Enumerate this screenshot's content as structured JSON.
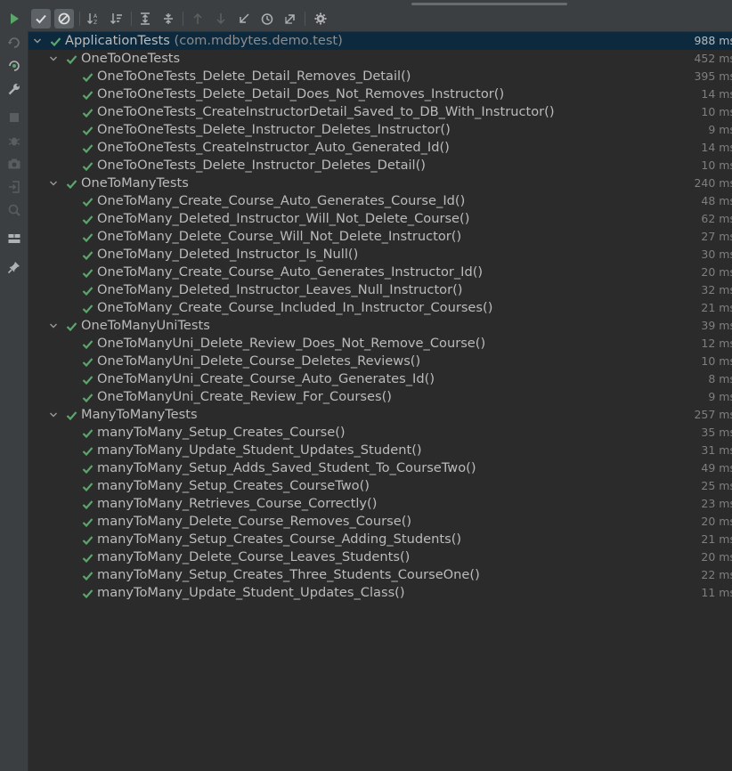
{
  "toolbar": {
    "buttons": [
      {
        "icon": "run-icon",
        "color": "#59a869"
      },
      {
        "icon": "show-passed-icon",
        "active": true
      },
      {
        "icon": "show-ignored-icon",
        "active": true
      },
      {
        "icon": "sort-alphabetically-icon"
      },
      {
        "icon": "sort-by-duration-icon"
      },
      {
        "icon": "expand-all-icon"
      },
      {
        "icon": "collapse-all-icon"
      },
      {
        "icon": "previous-failed-icon",
        "disabled": true
      },
      {
        "icon": "next-failed-icon",
        "disabled": true
      },
      {
        "icon": "import-tests-icon"
      },
      {
        "icon": "history-icon"
      },
      {
        "icon": "export-tests-icon"
      },
      {
        "icon": "settings-icon"
      }
    ]
  },
  "sidebar": {
    "icons": [
      "rerun-icon",
      "rerun-failed-icon",
      "toggle-auto-test-icon",
      "wrench-icon",
      "stop-icon",
      "debug-icon",
      "screenshot-icon",
      "exit-icon",
      "coverage-icon",
      "layout-icon",
      "pin-icon"
    ]
  },
  "colors": {
    "pass": "#59a869",
    "selected_row": "#0d293e",
    "background": "#2b2b2b"
  },
  "tree": {
    "root": {
      "name": "ApplicationTests",
      "package": "(com.mdbytes.demo.test)",
      "duration": "988 ms",
      "status": "passed",
      "suites": [
        {
          "name": "OneToOneTests",
          "duration": "452 ms",
          "tests": [
            {
              "name": "OneToOneTests_Delete_Detail_Removes_Detail()",
              "duration": "395 ms"
            },
            {
              "name": "OneToOneTests_Delete_Detail_Does_Not_Removes_Instructor()",
              "duration": "14 ms"
            },
            {
              "name": "OneToOneTests_CreateInstructorDetail_Saved_to_DB_With_Instructor()",
              "duration": "10 ms"
            },
            {
              "name": "OneToOneTests_Delete_Instructor_Deletes_Instructor()",
              "duration": "9 ms"
            },
            {
              "name": "OneToOneTests_CreateInstructor_Auto_Generated_Id()",
              "duration": "14 ms"
            },
            {
              "name": "OneToOneTests_Delete_Instructor_Deletes_Detail()",
              "duration": "10 ms"
            }
          ]
        },
        {
          "name": "OneToManyTests",
          "duration": "240 ms",
          "tests": [
            {
              "name": "OneToMany_Create_Course_Auto_Generates_Course_Id()",
              "duration": "48 ms"
            },
            {
              "name": "OneToMany_Deleted_Instructor_Will_Not_Delete_Course()",
              "duration": "62 ms"
            },
            {
              "name": "OneToMany_Delete_Course_Will_Not_Delete_Instructor()",
              "duration": "27 ms"
            },
            {
              "name": "OneToMany_Deleted_Instructor_Is_Null()",
              "duration": "30 ms"
            },
            {
              "name": "OneToMany_Create_Course_Auto_Generates_Instructor_Id()",
              "duration": "20 ms"
            },
            {
              "name": "OneToMany_Deleted_Instructor_Leaves_Null_Instructor()",
              "duration": "32 ms"
            },
            {
              "name": "OneToMany_Create_Course_Included_In_Instructor_Courses()",
              "duration": "21 ms"
            }
          ]
        },
        {
          "name": "OneToManyUniTests",
          "duration": "39 ms",
          "tests": [
            {
              "name": "OneToManyUni_Delete_Review_Does_Not_Remove_Course()",
              "duration": "12 ms"
            },
            {
              "name": "OneToManyUni_Delete_Course_Deletes_Reviews()",
              "duration": "10 ms"
            },
            {
              "name": "OneToManyUni_Create_Course_Auto_Generates_Id()",
              "duration": "8 ms"
            },
            {
              "name": "OneToManyUni_Create_Review_For_Courses()",
              "duration": "9 ms"
            }
          ]
        },
        {
          "name": "ManyToManyTests",
          "duration": "257 ms",
          "tests": [
            {
              "name": "manyToMany_Setup_Creates_Course()",
              "duration": "35 ms"
            },
            {
              "name": "manyToMany_Update_Student_Updates_Student()",
              "duration": "31 ms"
            },
            {
              "name": "manyToMany_Setup_Adds_Saved_Student_To_CourseTwo()",
              "duration": "49 ms"
            },
            {
              "name": "manyToMany_Setup_Creates_CourseTwo()",
              "duration": "25 ms"
            },
            {
              "name": "manyToMany_Retrieves_Course_Correctly()",
              "duration": "23 ms"
            },
            {
              "name": "manyToMany_Delete_Course_Removes_Course()",
              "duration": "20 ms"
            },
            {
              "name": "manyToMany_Setup_Creates_Course_Adding_Students()",
              "duration": "21 ms"
            },
            {
              "name": "manyToMany_Delete_Course_Leaves_Students()",
              "duration": "20 ms"
            },
            {
              "name": "manyToMany_Setup_Creates_Three_Students_CourseOne()",
              "duration": "22 ms"
            },
            {
              "name": "manyToMany_Update_Student_Updates_Class()",
              "duration": "11 ms"
            }
          ]
        }
      ]
    }
  }
}
